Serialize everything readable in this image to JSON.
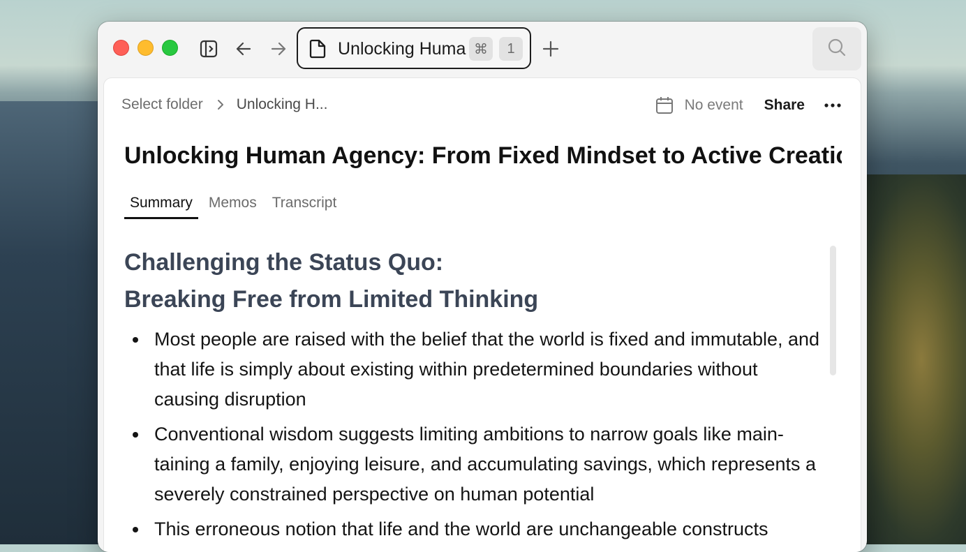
{
  "window": {
    "tab": {
      "title": "Unlocking Huma",
      "shortcut_symbol": "⌘",
      "shortcut_number": "1"
    }
  },
  "breadcrumb": {
    "folder": "Select folder",
    "current": "Unlocking H..."
  },
  "header": {
    "event_label": "No event",
    "share_label": "Share"
  },
  "document": {
    "title": "Unlocking Human Agency: From Fixed Mindset to Active Creatic",
    "tabs": [
      "Summary",
      "Memos",
      "Transcript"
    ],
    "active_tab": "Summary",
    "section_heading_line1": "Challenging the Status Quo:",
    "section_heading_line2": "Breaking Free from Limited Thinking",
    "bullets": [
      "Most people are raised with the belief that the world is fixed and immutable, and that life is simply about existing within predetermined boundaries without causing disruption",
      "Conventional wisdom suggests limiting ambitions to narrow goals like main­taining a family, enjoying leisure, and accumulating savings, which repre­sents a severely constrained perspective on human potential",
      "This erroneous notion that life and the world are unchangeable constructs"
    ]
  },
  "icons": {
    "sidebar_toggle": "sidebar-toggle-icon",
    "back": "arrow-left-icon",
    "forward": "arrow-right-icon",
    "document": "document-icon",
    "new_tab": "plus-icon",
    "search": "search-icon",
    "calendar": "calendar-icon",
    "more": "ellipsis-icon"
  },
  "colors": {
    "close": "#fe5f57",
    "minimize": "#febc2e",
    "maximize": "#28c840",
    "heading": "#3b4556"
  }
}
